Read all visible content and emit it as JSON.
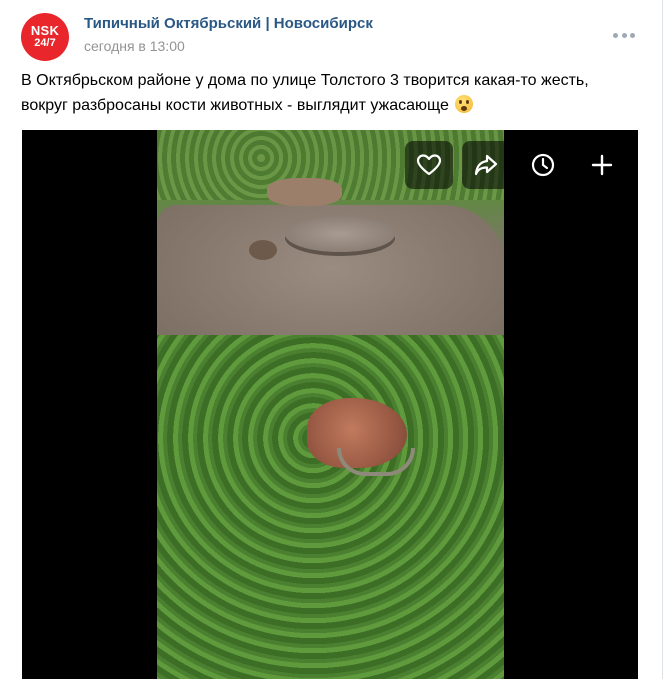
{
  "post": {
    "author": "Типичный Октябрьский | Новосибирск",
    "time": "сегодня в 13:00",
    "avatar": {
      "line1": "NSK",
      "line2": "24/7",
      "color": "#e8262b"
    },
    "text_line1": "В Октябрьском районе у дома по улице Толстого 3 творится какая-то жесть,",
    "text_line2": "вокруг разбросаны кости животных - выглядит ужасающе",
    "emoji": "anxious-face"
  },
  "video": {
    "controls": [
      "heart-icon",
      "share-icon",
      "clock-icon",
      "plus-icon"
    ]
  },
  "colors": {
    "author_link": "#2a5885",
    "secondary_text": "#939393"
  }
}
